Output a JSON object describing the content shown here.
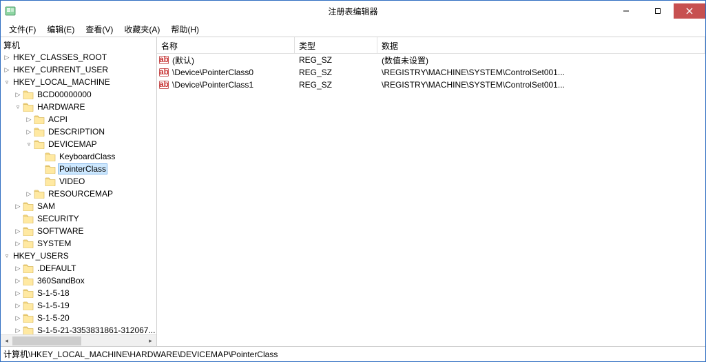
{
  "window": {
    "title": "注册表编辑器"
  },
  "menu": {
    "file": "文件(F)",
    "edit": "编辑(E)",
    "view": "查看(V)",
    "favorites": "收藏夹(A)",
    "help": "帮助(H)"
  },
  "tree": {
    "root_label": "算机",
    "selected": "PointerClass",
    "nodes": [
      {
        "label": "HKEY_CLASSES_ROOT",
        "depth": 0,
        "expander": "right",
        "icon": false
      },
      {
        "label": "HKEY_CURRENT_USER",
        "depth": 0,
        "expander": "right",
        "icon": false
      },
      {
        "label": "HKEY_LOCAL_MACHINE",
        "depth": 0,
        "expander": "down",
        "icon": false
      },
      {
        "label": "BCD00000000",
        "depth": 1,
        "expander": "right",
        "icon": true
      },
      {
        "label": "HARDWARE",
        "depth": 1,
        "expander": "down",
        "icon": true
      },
      {
        "label": "ACPI",
        "depth": 2,
        "expander": "right",
        "icon": true
      },
      {
        "label": "DESCRIPTION",
        "depth": 2,
        "expander": "right",
        "icon": true
      },
      {
        "label": "DEVICEMAP",
        "depth": 2,
        "expander": "down",
        "icon": true
      },
      {
        "label": "KeyboardClass",
        "depth": 3,
        "expander": "none",
        "icon": true
      },
      {
        "label": "PointerClass",
        "depth": 3,
        "expander": "none",
        "icon": true,
        "selected": true
      },
      {
        "label": "VIDEO",
        "depth": 3,
        "expander": "none",
        "icon": true
      },
      {
        "label": "RESOURCEMAP",
        "depth": 2,
        "expander": "right",
        "icon": true
      },
      {
        "label": "SAM",
        "depth": 1,
        "expander": "right",
        "icon": true
      },
      {
        "label": "SECURITY",
        "depth": 1,
        "expander": "none",
        "icon": true
      },
      {
        "label": "SOFTWARE",
        "depth": 1,
        "expander": "right",
        "icon": true
      },
      {
        "label": "SYSTEM",
        "depth": 1,
        "expander": "right",
        "icon": true
      },
      {
        "label": "HKEY_USERS",
        "depth": 0,
        "expander": "down",
        "icon": false
      },
      {
        "label": ".DEFAULT",
        "depth": 1,
        "expander": "right",
        "icon": true
      },
      {
        "label": "360SandBox",
        "depth": 1,
        "expander": "right",
        "icon": true
      },
      {
        "label": "S-1-5-18",
        "depth": 1,
        "expander": "right",
        "icon": true
      },
      {
        "label": "S-1-5-19",
        "depth": 1,
        "expander": "right",
        "icon": true
      },
      {
        "label": "S-1-5-20",
        "depth": 1,
        "expander": "right",
        "icon": true
      },
      {
        "label": "S-1-5-21-3353831861-312067...",
        "depth": 1,
        "expander": "right",
        "icon": true,
        "cut": true
      }
    ]
  },
  "list": {
    "headers": {
      "name": "名称",
      "type": "类型",
      "data": "数据"
    },
    "rows": [
      {
        "name": "(默认)",
        "type": "REG_SZ",
        "data": "(数值未设置)"
      },
      {
        "name": "\\Device\\PointerClass0",
        "type": "REG_SZ",
        "data": "\\REGISTRY\\MACHINE\\SYSTEM\\ControlSet001..."
      },
      {
        "name": "\\Device\\PointerClass1",
        "type": "REG_SZ",
        "data": "\\REGISTRY\\MACHINE\\SYSTEM\\ControlSet001..."
      }
    ]
  },
  "statusbar": {
    "path": "计算机\\HKEY_LOCAL_MACHINE\\HARDWARE\\DEVICEMAP\\PointerClass"
  }
}
